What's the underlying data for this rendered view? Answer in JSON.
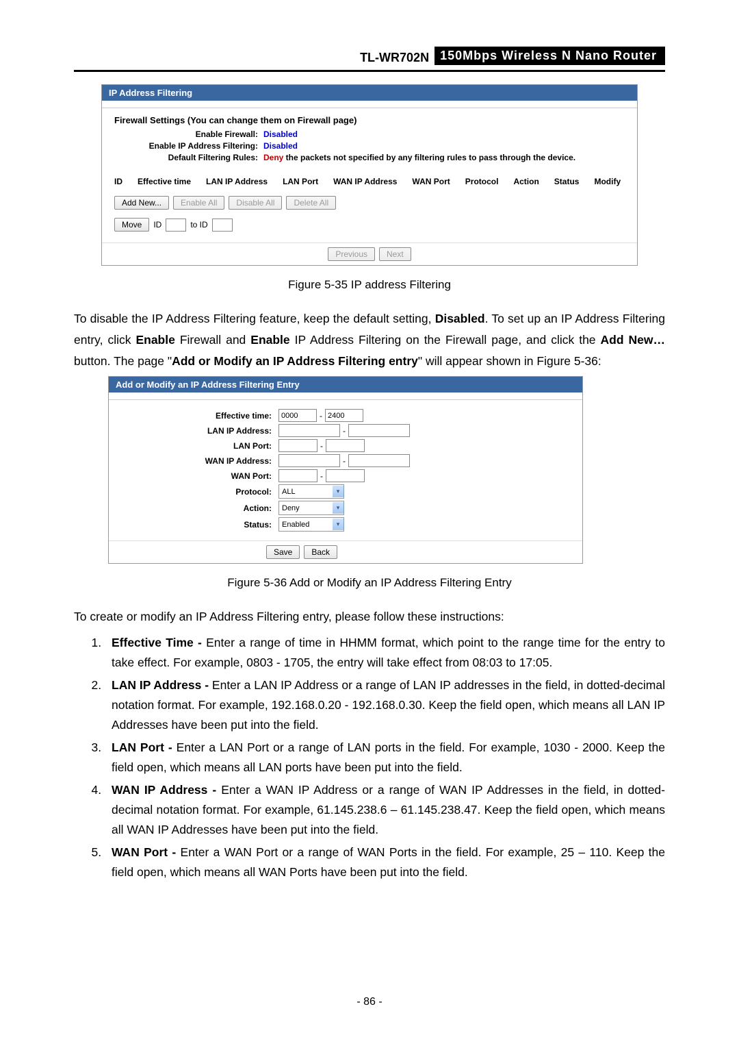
{
  "header": {
    "model": "TL-WR702N",
    "desc": "150Mbps  Wireless  N  Nano  Router"
  },
  "fig1": {
    "panel_title": "IP Address Filtering",
    "settings_title": "Firewall Settings (You can change them on Firewall page)",
    "rows": {
      "r1_label": "Enable Firewall:",
      "r1_val": "Disabled",
      "r2_label": "Enable IP Address Filtering:",
      "r2_val": "Disabled",
      "r3_label": "Default Filtering Rules:",
      "r3_deny": "Deny",
      "r3_rest": " the packets not specified by any filtering rules to pass through the device."
    },
    "cols": [
      "ID",
      "Effective time",
      "LAN IP Address",
      "LAN Port",
      "WAN IP Address",
      "WAN Port",
      "Protocol",
      "Action",
      "Status",
      "Modify"
    ],
    "buttons": {
      "add": "Add New...",
      "enable_all": "Enable All",
      "disable_all": "Disable All",
      "delete_all": "Delete All",
      "move": "Move",
      "id_lbl": "ID",
      "to_id_lbl": "to ID",
      "prev": "Previous",
      "next": "Next"
    },
    "caption": "Figure 5-35 IP address Filtering"
  },
  "para1": {
    "p1a": "To disable the IP Address Filtering feature, keep the default setting, ",
    "p1b": "Disabled",
    "p1c": ". To set up an IP Address Filtering entry, click ",
    "p1d": "Enable",
    "p1e": " Firewall and ",
    "p1f": "Enable",
    "p1g": " IP Address Filtering on the Firewall page, and click the ",
    "p1h": "Add New…",
    "p1i": " button. The page \"",
    "p1j": "Add or Modify an IP Address Filtering entry",
    "p1k": "\" will appear shown in Figure 5-36:"
  },
  "fig2": {
    "panel_title": "Add or Modify an IP Address Filtering Entry",
    "labels": {
      "eff": "Effective time:",
      "lan_ip": "LAN IP Address:",
      "lan_port": "LAN Port:",
      "wan_ip": "WAN IP Address:",
      "wan_port": "WAN Port:",
      "protocol": "Protocol:",
      "action": "Action:",
      "status": "Status:"
    },
    "values": {
      "eff_from": "0000",
      "eff_to": "2400",
      "protocol": "ALL",
      "action": "Deny",
      "status": "Enabled"
    },
    "buttons": {
      "save": "Save",
      "back": "Back"
    },
    "caption": "Figure 5-36 Add or Modify an IP Address Filtering Entry"
  },
  "intro2": "To create or modify an IP Address Filtering entry, please follow these instructions:",
  "list": [
    {
      "b": "Effective Time -",
      "t": " Enter a range of time in HHMM format, which point to the range time for the entry to take effect. For example, 0803 - 1705, the entry will take effect from 08:03 to 17:05."
    },
    {
      "b": "LAN IP Address -",
      "t": " Enter a LAN IP Address or a range of LAN IP addresses in the field, in dotted-decimal notation format. For example, 192.168.0.20 - 192.168.0.30. Keep the field open, which means all LAN IP Addresses have been put into the field."
    },
    {
      "b": "LAN Port -",
      "t": " Enter a LAN Port or a range of LAN ports in the field. For example, 1030 - 2000. Keep the field open, which means all LAN ports have been put into the field."
    },
    {
      "b": "WAN IP Address -",
      "t": " Enter a WAN IP Address or a range of WAN IP Addresses in the field, in dotted-decimal notation format. For example, 61.145.238.6 – 61.145.238.47. Keep the field open, which means all WAN IP Addresses have been put into the field."
    },
    {
      "b": "WAN Port -",
      "t": " Enter a WAN Port or a range of WAN Ports in the field. For example, 25 – 110. Keep the field open, which means all WAN Ports have been put into the field."
    }
  ],
  "page_number": "- 86 -"
}
